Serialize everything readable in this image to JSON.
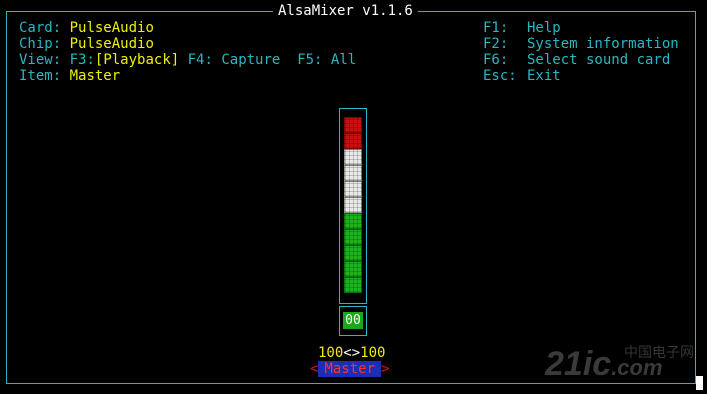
{
  "window": {
    "title": "AlsaMixer v1.1.6"
  },
  "info": {
    "card_label": "Card:",
    "card_value": "PulseAudio",
    "chip_label": "Chip:",
    "chip_value": "PulseAudio",
    "view_label": "View:",
    "view_f3": "F3:",
    "view_playback": "[Playback]",
    "view_rest": " F4: Capture  F5: All",
    "item_label": "Item:",
    "item_value": "Master"
  },
  "keys": [
    {
      "key": "F1:",
      "desc": "Help"
    },
    {
      "key": "F2:",
      "desc": "System information"
    },
    {
      "key": "F6:",
      "desc": "Select sound card"
    },
    {
      "key": "Esc:",
      "desc": "Exit"
    }
  ],
  "mixer": {
    "channel_name": "Master",
    "volume_left": "100",
    "volume_arrows": "<>",
    "volume_right": "100",
    "mute_state": "00",
    "level_fraction": 1.0,
    "bar_colors": {
      "high": "#c4130c",
      "mid": "#e8e8e8",
      "low": "#1ab51a"
    }
  },
  "watermark": {
    "text": "21ic",
    "site": "中国电子网",
    "domain": ".com"
  },
  "colors": {
    "accent": "#2ab7c4",
    "value": "#f0f000",
    "channel_bg": "#1a2fb5",
    "channel_fg": "#ff3030"
  }
}
